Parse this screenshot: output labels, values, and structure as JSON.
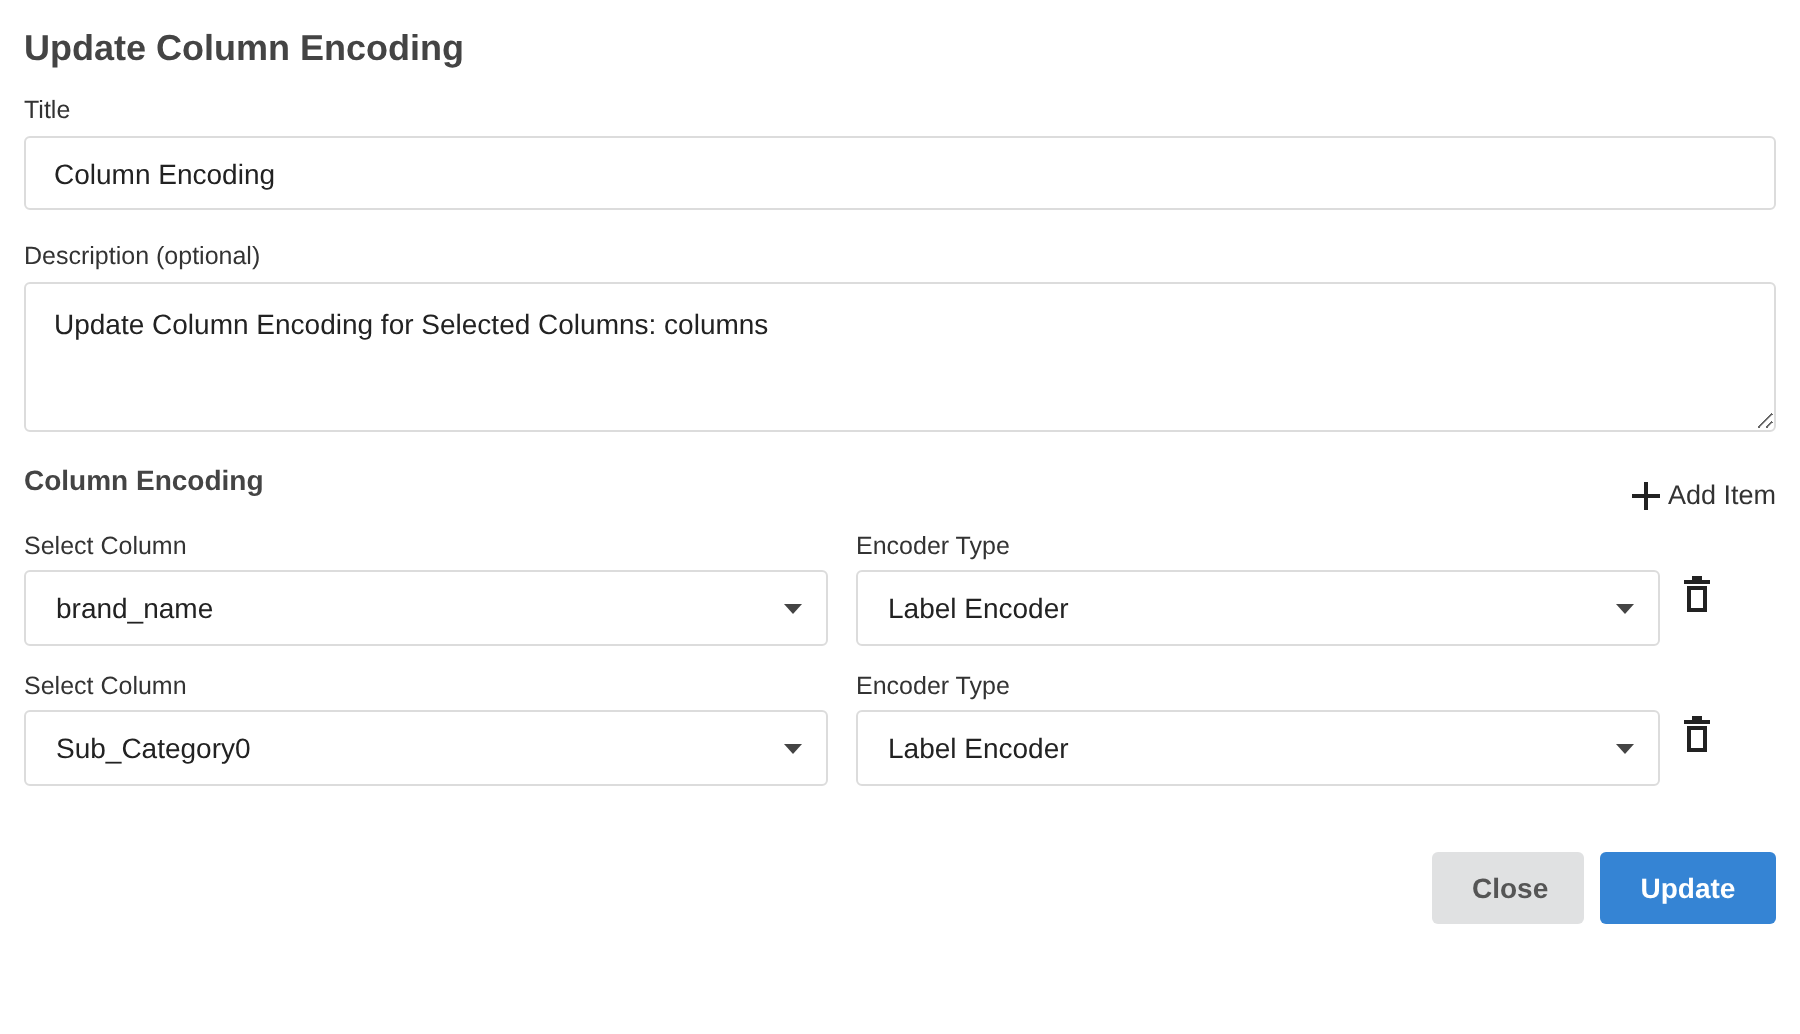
{
  "dialog": {
    "title": "Update Column Encoding"
  },
  "title_field": {
    "label": "Title",
    "value": "Column Encoding"
  },
  "description_field": {
    "label": "Description (optional)",
    "value": "Update Column Encoding for Selected Columns: columns"
  },
  "encoding": {
    "heading": "Column Encoding",
    "add_button": "Add Item",
    "items": [
      {
        "column_label": "Select Column",
        "column_value": "brand_name",
        "encoder_label": "Encoder Type",
        "encoder_value": "Label Encoder"
      },
      {
        "column_label": "Select Column",
        "column_value": "Sub_Category0",
        "encoder_label": "Encoder Type",
        "encoder_value": "Label Encoder"
      }
    ]
  },
  "buttons": [
    {
      "label": "Close",
      "kind": "secondary"
    },
    {
      "label": "Update",
      "kind": "primary"
    }
  ]
}
